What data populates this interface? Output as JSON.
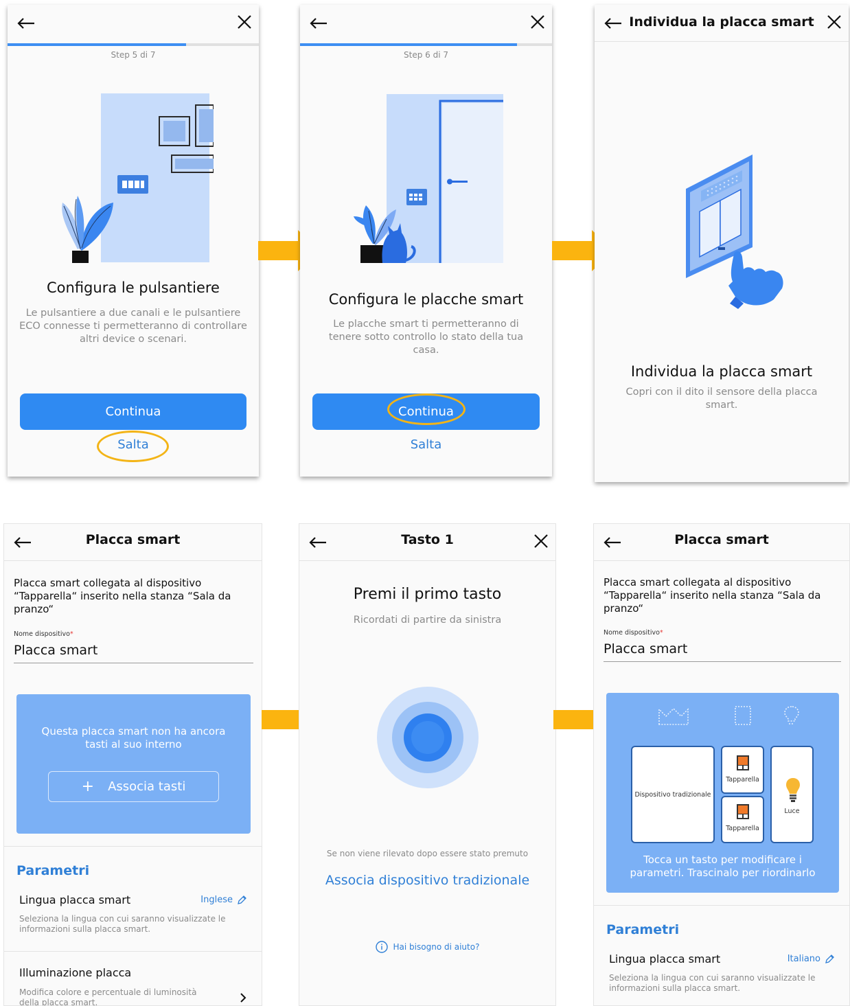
{
  "screen1": {
    "step_text": "Step 5 di 7",
    "progress": 0.71,
    "heading": "Configura le pulsantiere",
    "description": "Le pulsantiere a due canali e le pulsantiere ECO connesse ti permetteranno di controllare altri device o scenari.",
    "continue_label": "Continua",
    "skip_label": "Salta"
  },
  "screen2": {
    "step_text": "Step 6 di 7",
    "progress": 0.86,
    "heading": "Configura le placche smart",
    "description": "Le placche smart ti permetteranno di tenere sotto controllo lo stato della tua casa.",
    "continue_label": "Continua",
    "skip_label": "Salta"
  },
  "screen3": {
    "title": "Individua la placca smart",
    "heading": "Individua la placca smart",
    "description": "Copri con il dito il sensore della placca smart."
  },
  "screen4": {
    "title": "Placca smart",
    "info": "Placca smart collegata al dispositivo “Tapparella“ inserito nella stanza “Sala da pranzo“",
    "field_label": "Nome dispositivo",
    "field_value": "Placca smart",
    "card_text": "Questa placca smart non ha ancora tasti al suo interno",
    "associate_label": "Associa tasti",
    "plus_symbol": "+",
    "params_title": "Parametri",
    "lang_title": "Lingua placca smart",
    "lang_value": "Inglese",
    "lang_desc": "Seleziona la lingua con cui saranno visualizzate le informazioni sulla placca smart.",
    "light_title": "Illuminazione placca",
    "light_desc": "Modifica colore e percentuale di luminosità della placca smart."
  },
  "screen5": {
    "title": "Tasto 1",
    "heading": "Premi il primo tasto",
    "subheading": "Ricordati di partire da sinistra",
    "hint": "Se non viene rilevato dopo essere stato premuto",
    "associate_link": "Associa dispositivo tradizionale",
    "help_link": "Hai bisogno di aiuto?"
  },
  "screen6": {
    "title": "Placca smart",
    "info": "Placca smart collegata al dispositivo “Tapparella“ inserito nella stanza “Sala da pranzo“",
    "field_label": "Nome dispositivo",
    "field_value": "Placca smart",
    "key_traditional": "Dispositivo tradizionale",
    "key_shutter_1": "Tapparella",
    "key_shutter_2": "Tapparella",
    "key_light": "Luce",
    "card_text": "Tocca un tasto per modificare i parametri. Trascinalo per riordinarlo",
    "params_title": "Parametri",
    "lang_title": "Lingua placca smart",
    "lang_value": "Italiano",
    "lang_desc": "Seleziona la lingua con cui saranno visualizzate le informazioni sulla placca smart."
  },
  "colors": {
    "primary": "#2f8af2",
    "link": "#2f7fd6",
    "highlight": "#f3b416",
    "arrow": "#fbb40f",
    "illustration_bg": "#c7dcfb"
  }
}
